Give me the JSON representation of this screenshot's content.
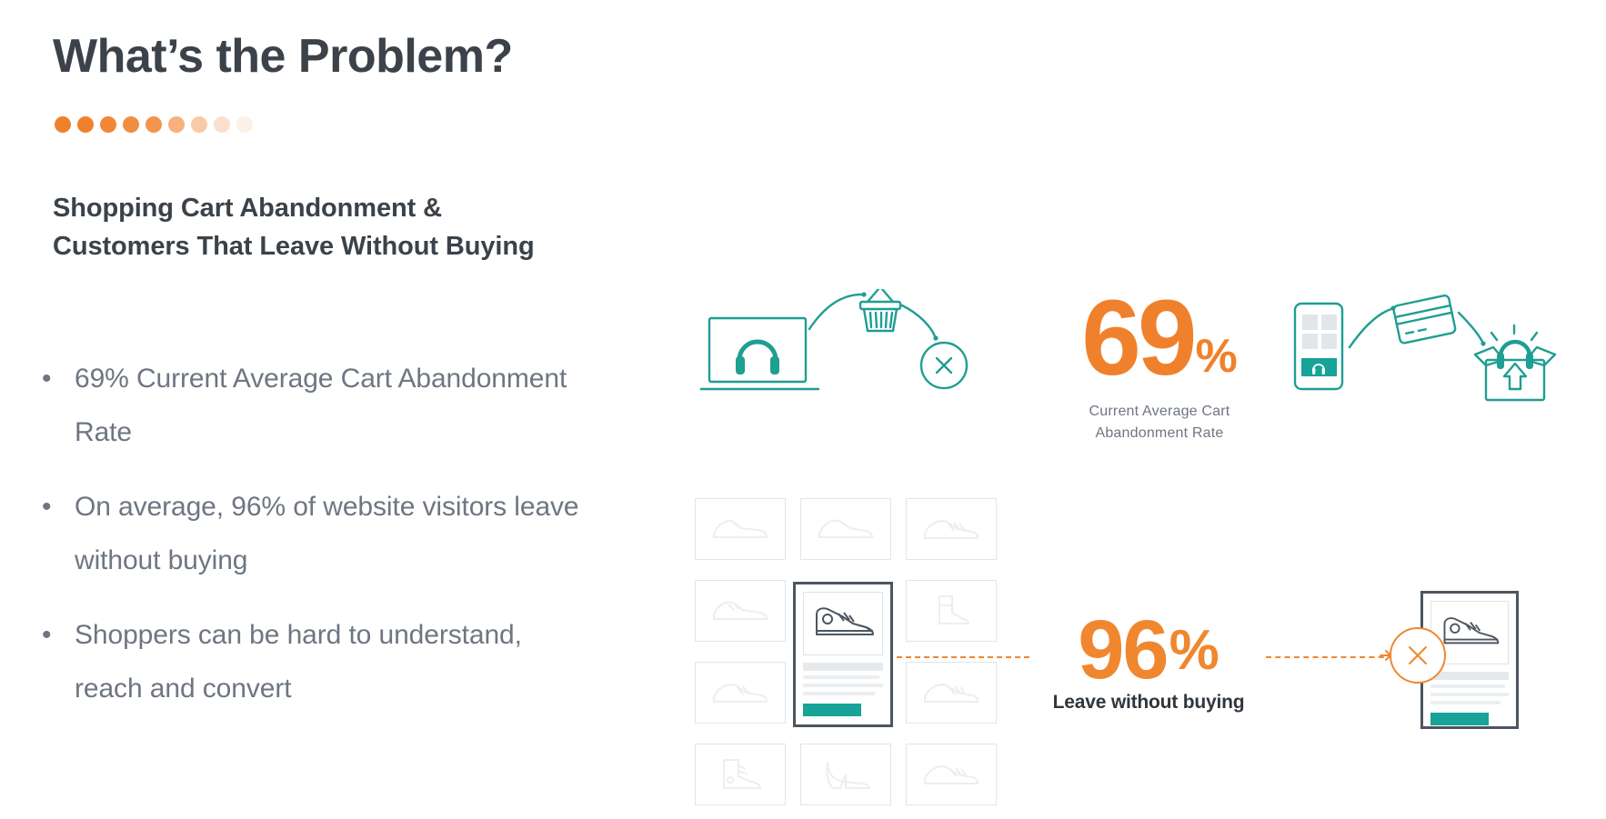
{
  "slide": {
    "title": "What’s the Problem?",
    "subheading_line1": "Shopping Cart Abandonment &",
    "subheading_line2": "Customers That Leave Without Buying",
    "bullet_marker": "•",
    "bullets": [
      "69% Current Average Cart Abandonment Rate",
      "On average, 96% of website visitors leave without buying",
      "Shoppers can be hard to understand, reach and convert"
    ],
    "progress_dots": [
      {
        "opacity": 1.0
      },
      {
        "opacity": 1.0
      },
      {
        "opacity": 0.95
      },
      {
        "opacity": 0.9
      },
      {
        "opacity": 0.85
      },
      {
        "opacity": 0.62
      },
      {
        "opacity": 0.42
      },
      {
        "opacity": 0.24
      },
      {
        "opacity": 0.12
      }
    ]
  },
  "stats": {
    "cart_abandonment": {
      "number": "69",
      "percent": "%",
      "caption_line1": "Current Average Cart",
      "caption_line2": "Abandonment Rate"
    },
    "leave_without_buying": {
      "number": "96",
      "percent": "%",
      "caption": "Leave without buying"
    }
  },
  "colors": {
    "orange": "#f0812c",
    "orange_stat": "#f0872f",
    "teal": "#17a398",
    "dark": "#3b4249",
    "body_gray": "#6e7682",
    "card_border": "#e2e5e8",
    "feature_border": "#4c5660"
  },
  "illustrations": {
    "top_left": {
      "name": "laptop-basket-abandon",
      "items": [
        "laptop-icon",
        "headphones-icon",
        "shopping-basket-icon",
        "x-circle-icon"
      ]
    },
    "top_right": {
      "name": "phone-card-box-purchase",
      "items": [
        "phone-icon",
        "headphones-icon",
        "credit-card-icon",
        "open-box-icon",
        "up-arrow-icon"
      ]
    },
    "shoe_grid": {
      "rows": [
        [
          "dress-shoe-icon",
          "sneaker-low-icon",
          "sneaker-stripe-icon"
        ],
        [
          "oxford-shoe-icon",
          "highlighted-product-card",
          "ankle-boot-icon"
        ],
        [
          "running-shoe-icon",
          "highlighted-product-card",
          "trainer-icon"
        ],
        [
          "work-boot-icon",
          "high-heel-icon",
          "sneaker-icon"
        ]
      ]
    },
    "feature_card": {
      "name": "selected-product-card",
      "image": "high-top-sneaker-icon",
      "cta": "buy-button"
    },
    "right_card": {
      "name": "abandoned-product-card",
      "image": "high-top-sneaker-icon",
      "cta": "buy-button",
      "overlay": "x-circle-icon"
    }
  }
}
